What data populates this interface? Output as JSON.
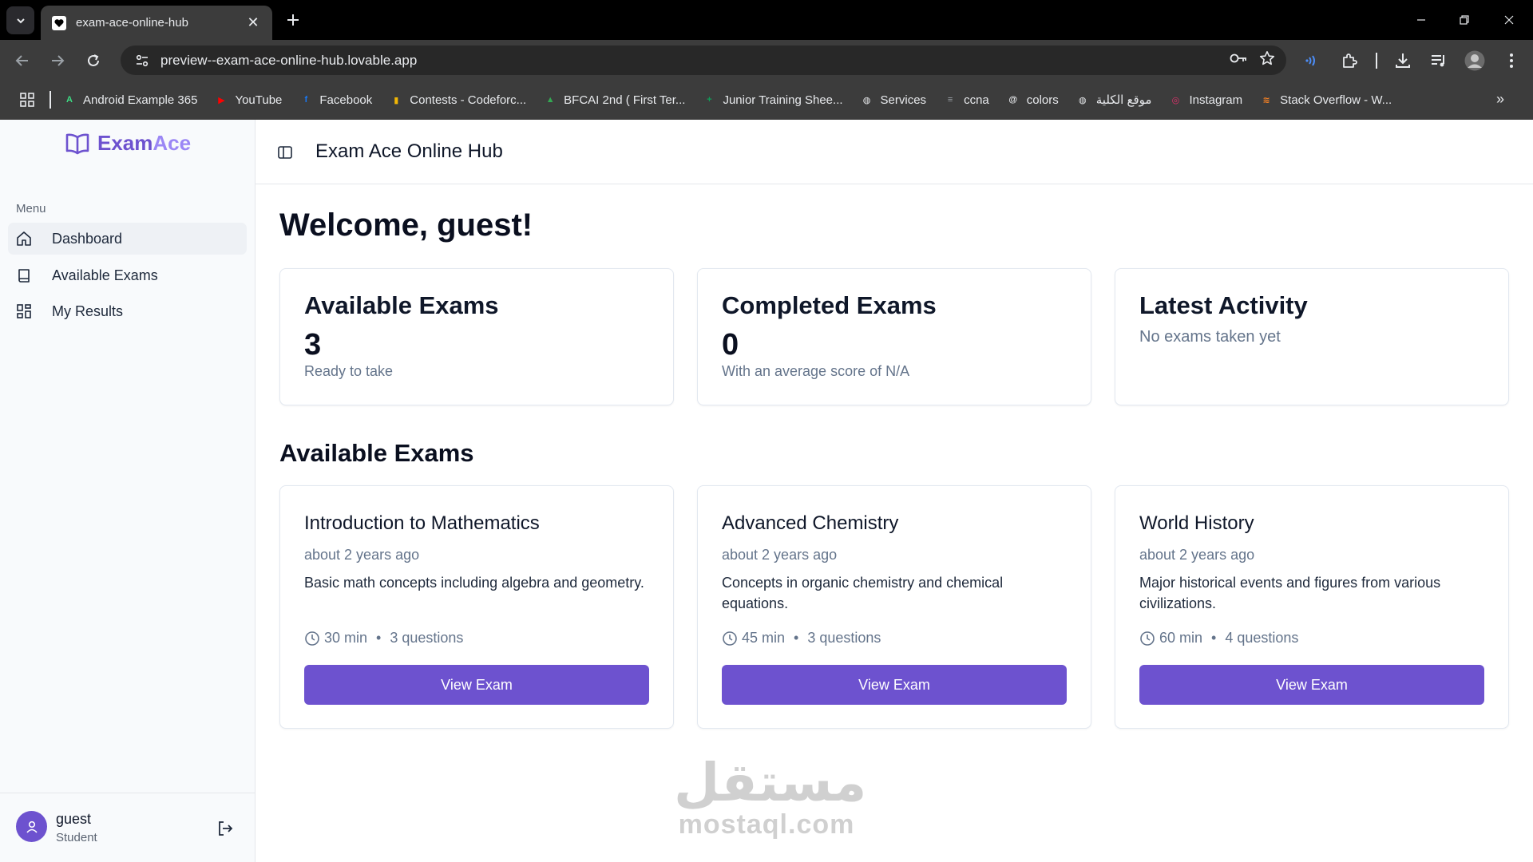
{
  "browser": {
    "tab_title": "exam-ace-online-hub",
    "url": "preview--exam-ace-online-hub.lovable.app",
    "bookmarks": [
      {
        "label": "Android Example 365",
        "icon": "android-icon",
        "color": "#3ddc84"
      },
      {
        "label": "YouTube",
        "icon": "youtube-icon",
        "color": "#ff0000"
      },
      {
        "label": "Facebook",
        "icon": "facebook-icon",
        "color": "#1877f2"
      },
      {
        "label": "Contests - Codeforc...",
        "icon": "codeforces-icon",
        "color": "#f2b705"
      },
      {
        "label": "BFCAI 2nd ( First Ter...",
        "icon": "drive-icon",
        "color": "#34a853"
      },
      {
        "label": "Junior Training Shee...",
        "icon": "sheets-icon",
        "color": "#0f9d58"
      },
      {
        "label": "Services",
        "icon": "globe-icon",
        "color": "#e8eaed"
      },
      {
        "label": "ccna",
        "icon": "cisco-icon",
        "color": "#9aa0a6"
      },
      {
        "label": "colors",
        "icon": "colors-icon",
        "color": "#e8eaed"
      },
      {
        "label": "موقع الكلية",
        "icon": "globe-icon",
        "color": "#e8eaed"
      },
      {
        "label": "Instagram",
        "icon": "instagram-icon",
        "color": "#e1306c"
      },
      {
        "label": "Stack Overflow - W...",
        "icon": "stackoverflow-icon",
        "color": "#f48024"
      }
    ]
  },
  "sidebar": {
    "brand_part1": "Exam",
    "brand_part2": "Ace",
    "menu_label": "Menu",
    "items": [
      {
        "label": "Dashboard",
        "icon": "home-icon",
        "active": true
      },
      {
        "label": "Available Exams",
        "icon": "book-icon",
        "active": false
      },
      {
        "label": "My Results",
        "icon": "grid-icon",
        "active": false
      }
    ],
    "user": {
      "name": "guest",
      "role": "Student"
    }
  },
  "header": {
    "title": "Exam Ace Online Hub"
  },
  "main": {
    "welcome": "Welcome, guest!",
    "stats": [
      {
        "title": "Available Exams",
        "value": "3",
        "subtitle": "Ready to take"
      },
      {
        "title": "Completed Exams",
        "value": "0",
        "subtitle": "With an average score of N/A"
      },
      {
        "title": "Latest Activity",
        "value": "",
        "subtitle": "No exams taken yet"
      }
    ],
    "section_title": "Available Exams",
    "exams": [
      {
        "title": "Introduction to Mathematics",
        "date": "about 2 years ago",
        "description": "Basic math concepts including algebra and geometry.",
        "duration": "30 min",
        "dot": "•",
        "questions": "3 questions",
        "button": "View Exam"
      },
      {
        "title": "Advanced Chemistry",
        "date": "about 2 years ago",
        "description": "Concepts in organic chemistry and chemical equations.",
        "duration": "45 min",
        "dot": "•",
        "questions": "3 questions",
        "button": "View Exam"
      },
      {
        "title": "World History",
        "date": "about 2 years ago",
        "description": "Major historical events and figures from various civilizations.",
        "duration": "60 min",
        "dot": "•",
        "questions": "4 questions",
        "button": "View Exam"
      }
    ]
  },
  "watermark": {
    "arabic": "مستقل",
    "latin": "mostaql.com"
  },
  "colors": {
    "accent": "#6d52cf",
    "accent_light": "#9b87f5",
    "muted_text": "#64748b"
  }
}
